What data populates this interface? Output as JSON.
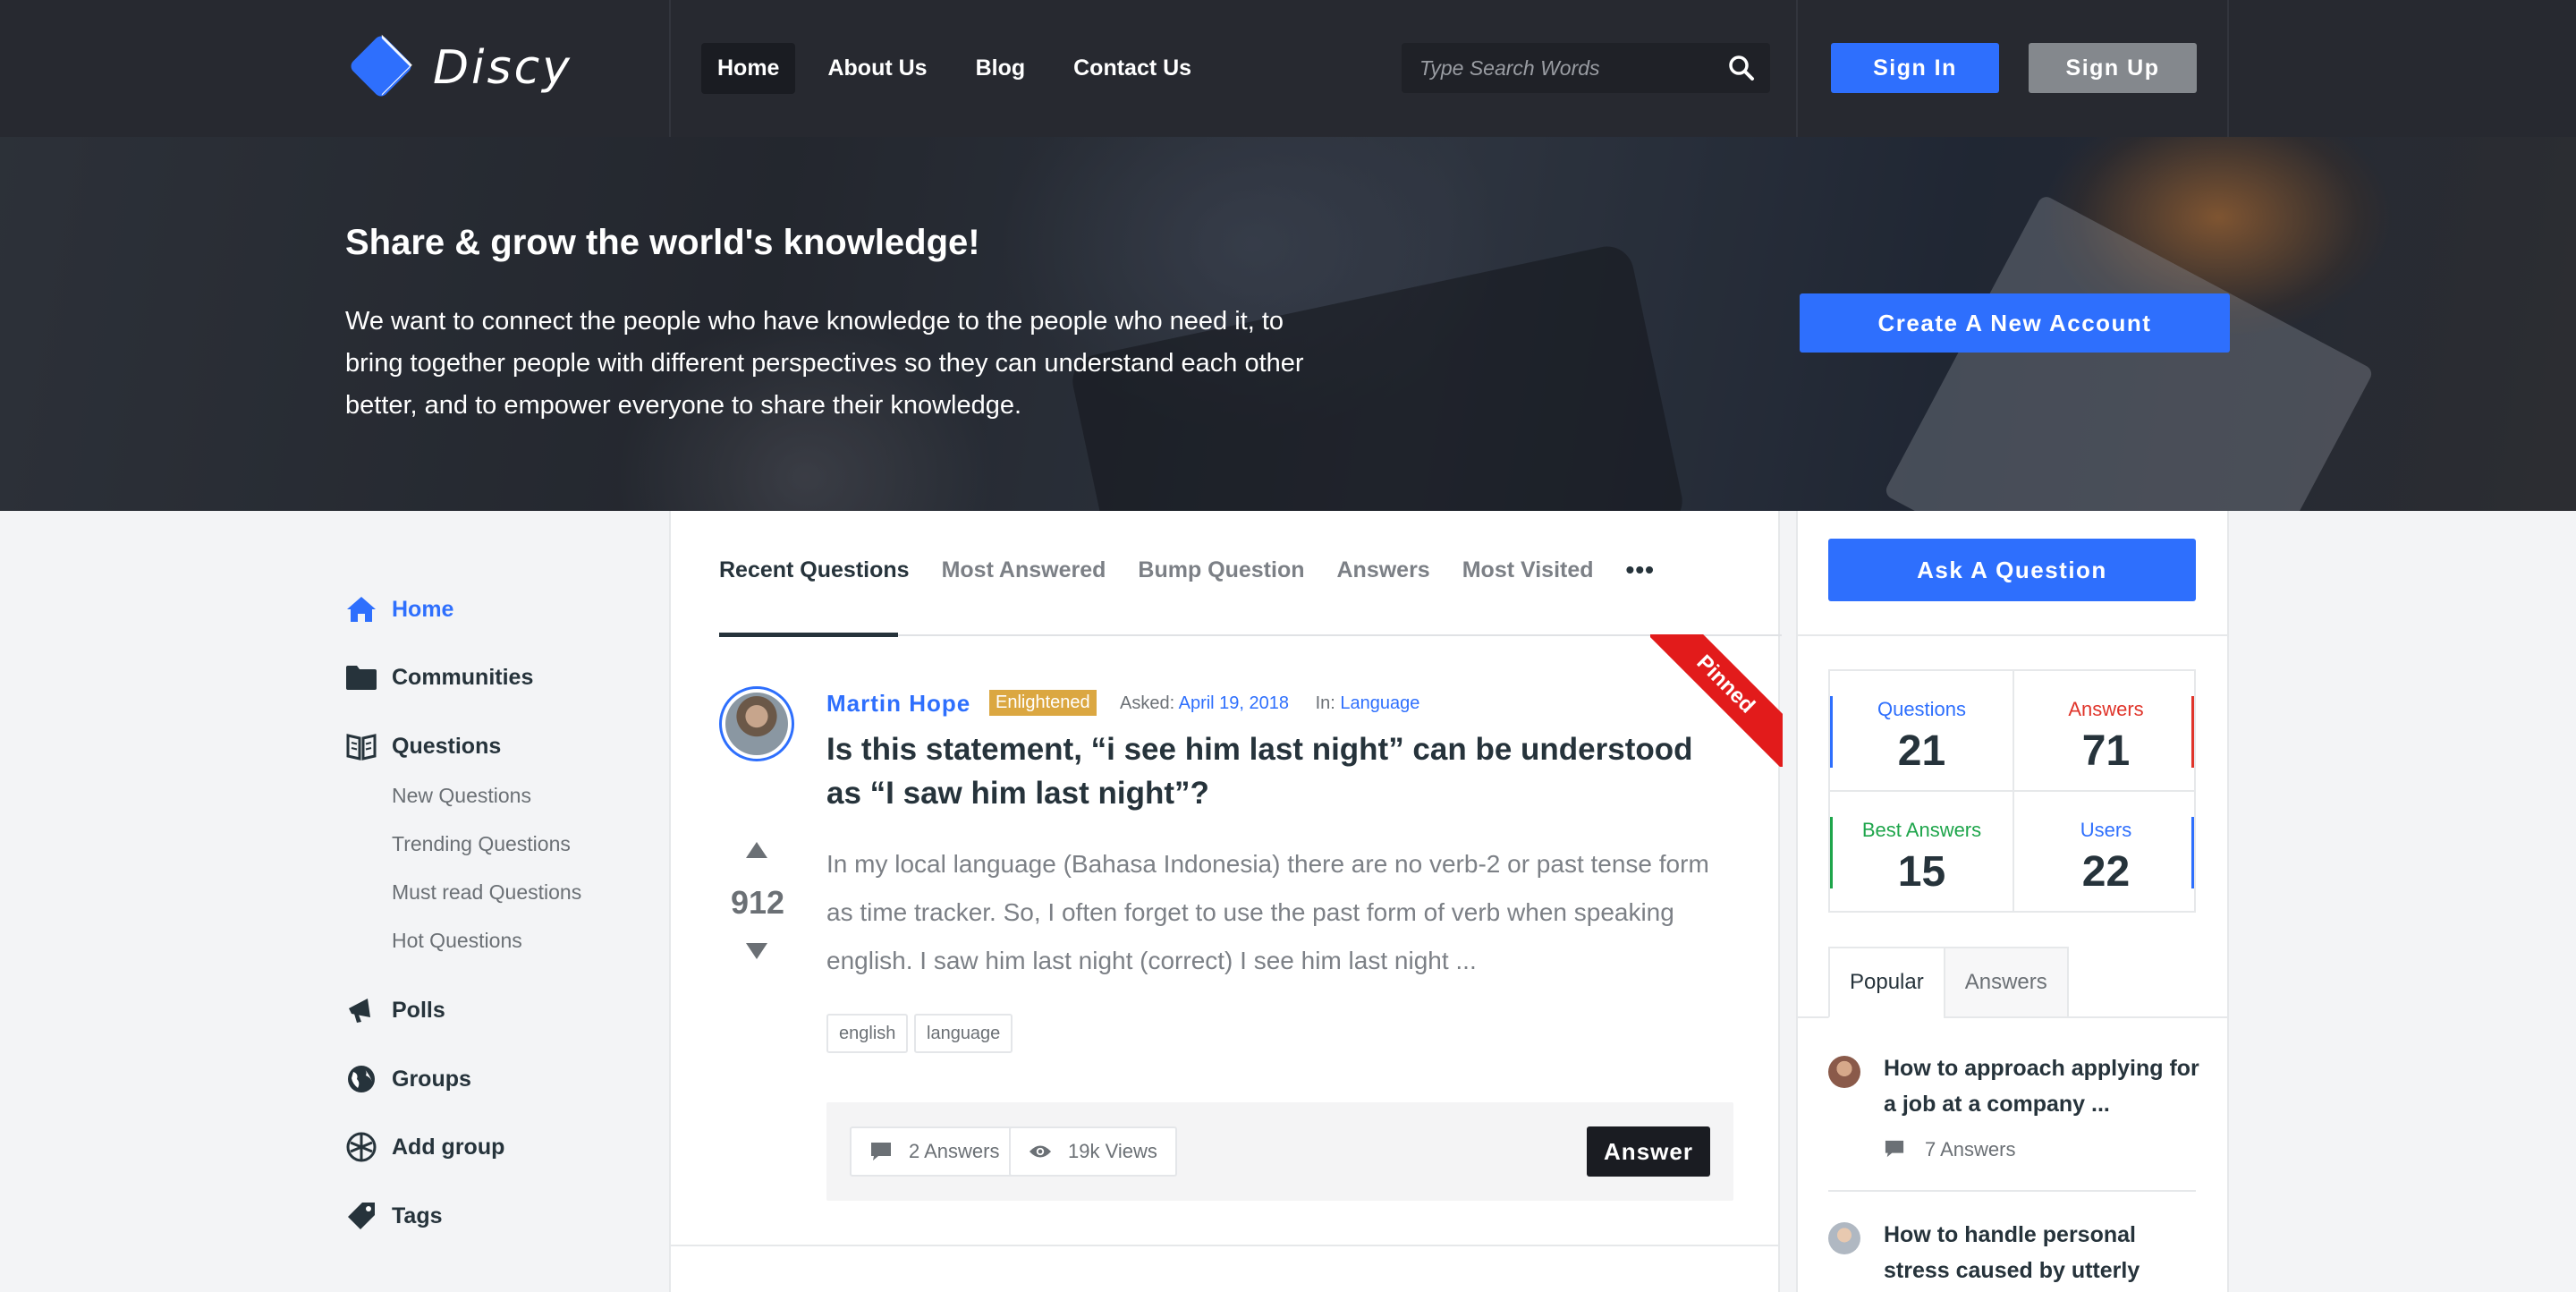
{
  "header": {
    "logo_text": "Discy",
    "nav": [
      "Home",
      "About Us",
      "Blog",
      "Contact Us"
    ],
    "search_placeholder": "Type Search Words",
    "sign_in": "Sign In",
    "sign_up": "Sign Up"
  },
  "hero": {
    "title": "Share & grow the world's knowledge!",
    "text": "We want to connect the people who have knowledge to the people who need it, to bring together people with different perspectives so they can understand each other better, and to empower everyone to share their knowledge.",
    "create_account": "Create A New Account"
  },
  "sidebar": {
    "items": [
      {
        "label": "Home",
        "icon": "home-icon"
      },
      {
        "label": "Communities",
        "icon": "folder-icon"
      },
      {
        "label": "Questions",
        "icon": "book-icon"
      },
      {
        "label": "Polls",
        "icon": "megaphone-icon"
      },
      {
        "label": "Groups",
        "icon": "globe-icon"
      },
      {
        "label": "Add group",
        "icon": "globe-add-icon"
      },
      {
        "label": "Tags",
        "icon": "tag-icon"
      }
    ],
    "sub_items": [
      "New Questions",
      "Trending Questions",
      "Must read Questions",
      "Hot Questions"
    ]
  },
  "main": {
    "tabs": [
      "Recent Questions",
      "Most Answered",
      "Bump Question",
      "Answers",
      "Most Visited"
    ],
    "more_label": "•••",
    "question": {
      "ribbon": "Pinned",
      "author": "Martin Hope",
      "badge": "Enlightened",
      "asked_label": "Asked:",
      "asked_date": "April 19, 2018",
      "in_label": "In:",
      "category": "Language",
      "title": "Is this statement, “i see him last night” can be understood as “I saw him last night”?",
      "votes": "912",
      "excerpt": "In my local language (Bahasa Indonesia) there are no verb-2 or past tense form as time tracker. So, I often forget to use the past form of verb when speaking english. I saw him last night (correct) I see him last night ...",
      "tags": [
        "english",
        "language"
      ],
      "answers": "2 Answers",
      "views": "19k Views",
      "answer_button": "Answer"
    }
  },
  "right": {
    "ask_button": "Ask A Question",
    "stats": [
      {
        "label": "Questions",
        "value": "21",
        "color": "#2e6ffd"
      },
      {
        "label": "Answers",
        "value": "71",
        "color": "#e0352b"
      },
      {
        "label": "Best Answers",
        "value": "15",
        "color": "#1ea54b"
      },
      {
        "label": "Users",
        "value": "22",
        "color": "#2e6ffd"
      }
    ],
    "tabs": [
      "Popular",
      "Answers"
    ],
    "popular": [
      {
        "title": "How to approach applying for a job at a company ...",
        "meta": "7 Answers"
      },
      {
        "title": "How to handle personal stress caused by utterly incompetent"
      }
    ]
  },
  "colors": {
    "accent": "#2e6ffd",
    "header_bg": "#272930",
    "badge": "#dba741",
    "ribbon": "#e21b1b"
  }
}
